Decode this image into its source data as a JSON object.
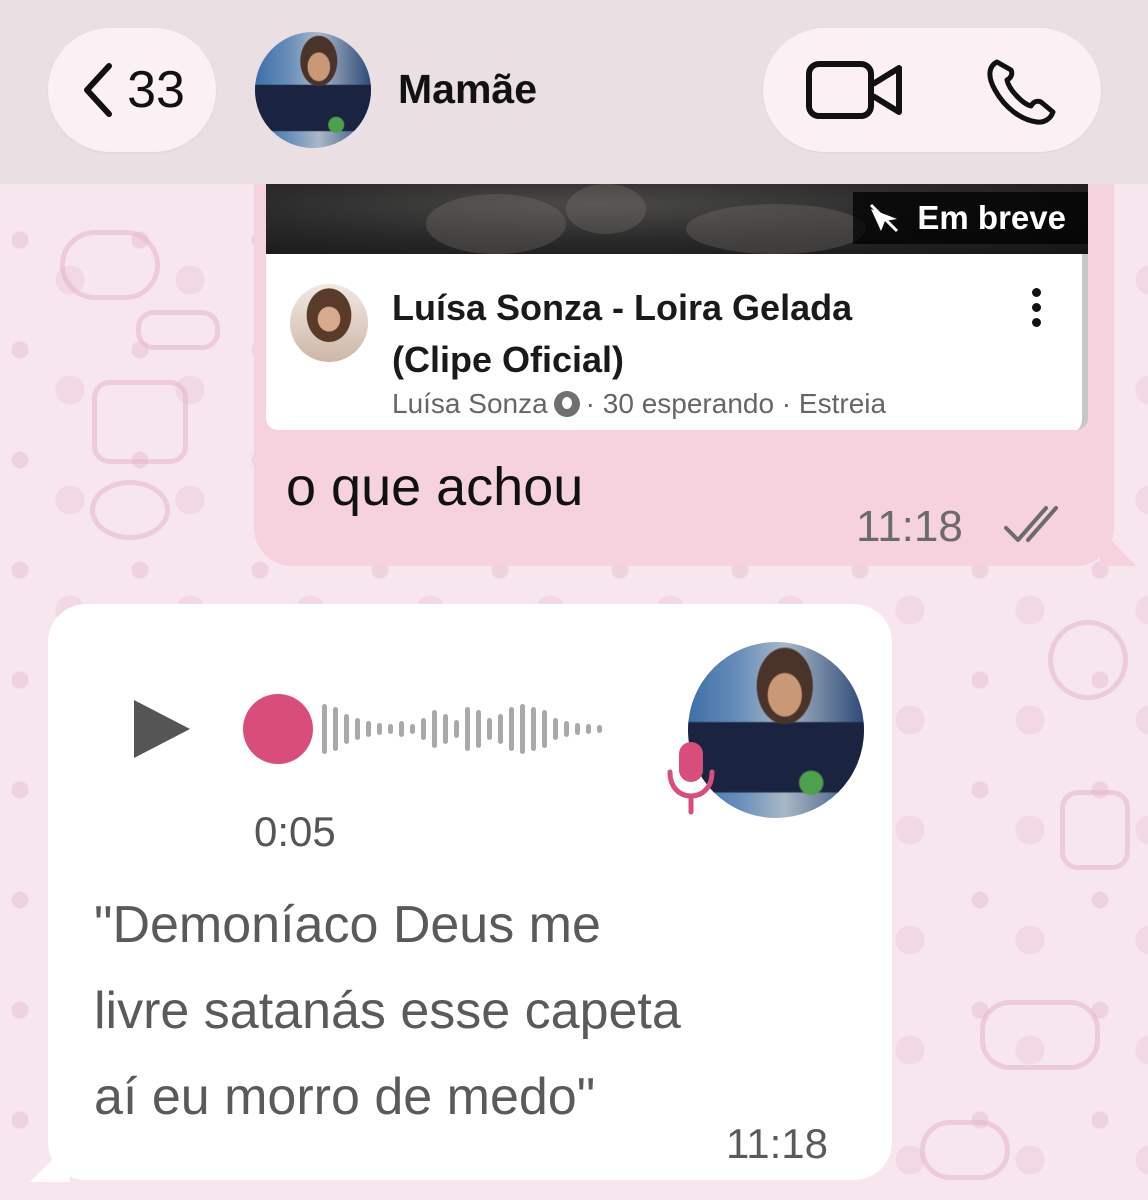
{
  "header": {
    "back_count": "33",
    "contact_name": "Mamãe",
    "icons": [
      "chevron-left-icon",
      "video-call-icon",
      "phone-icon"
    ]
  },
  "outgoing_message": {
    "link_preview": {
      "badge_text": "Em breve",
      "title_line1": "Luísa Sonza - Loira Gelada",
      "title_line2": "(Clipe Oficial)",
      "channel": "Luísa Sonza",
      "meta": "· 30 esperando · Estreia"
    },
    "text": "o que achou",
    "time": "11:18",
    "status": "read"
  },
  "incoming_message": {
    "duration": "0:05",
    "playback_progress": 0,
    "transcript_line1": "\"Demoníaco Deus me",
    "transcript_line2": "livre satanás esse capeta",
    "transcript_line3": "aí eu morro de medo\"",
    "time": "11:18"
  },
  "colors": {
    "outgoing_bubble": "#f6d1de",
    "incoming_bubble": "#ffffff",
    "accent_pink": "#d94d7a",
    "header_bg": "#eadfe3"
  }
}
